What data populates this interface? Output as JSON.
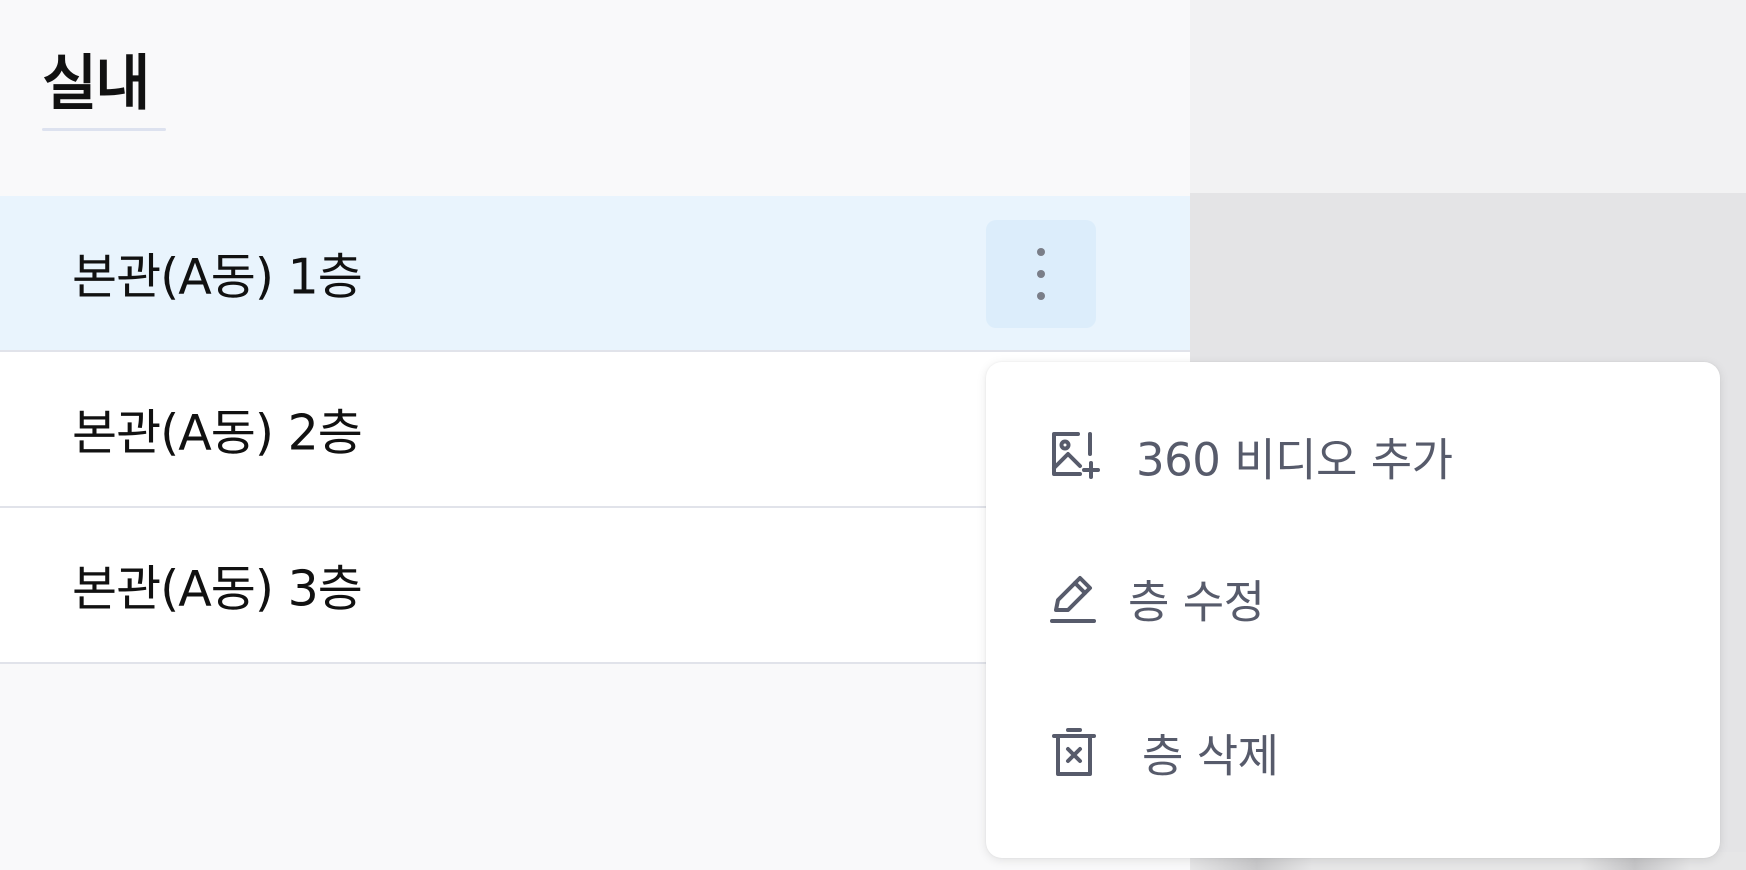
{
  "sidebar": {
    "section_title": "실내",
    "floors": [
      {
        "label": "본관(A동) 1층",
        "active": true
      },
      {
        "label": "본관(A동) 2층",
        "active": false
      },
      {
        "label": "본관(A동) 3층",
        "active": false
      }
    ]
  },
  "context_menu": {
    "items": [
      {
        "label": "360 비디오 추가",
        "icon": "add-image-icon"
      },
      {
        "label": "층 수정",
        "icon": "pencil-icon"
      },
      {
        "label": "층 삭제",
        "icon": "trash-icon"
      }
    ]
  },
  "colors": {
    "active_row": "#e9f4fd",
    "menu_text": "#575b6b",
    "kebab_bg": "#dcedfb"
  }
}
